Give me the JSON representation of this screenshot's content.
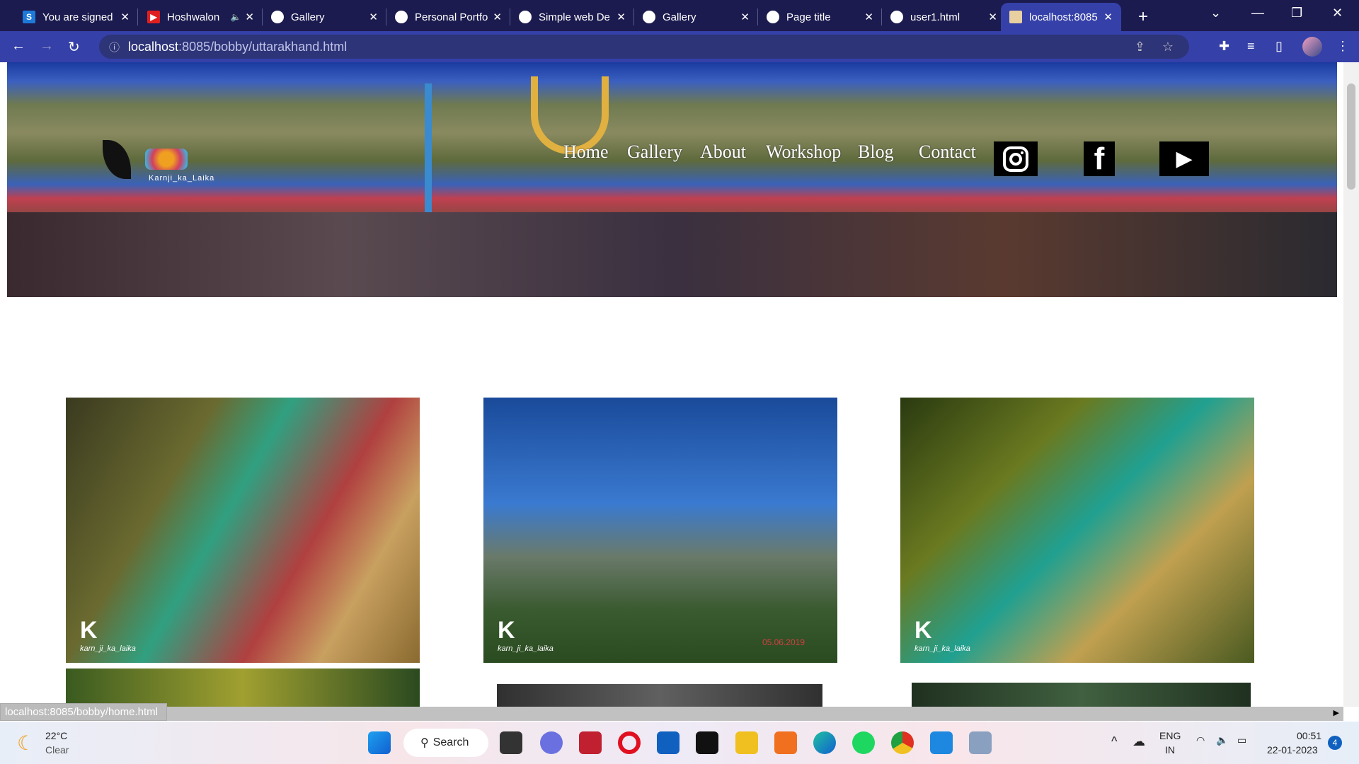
{
  "browser": {
    "tabs": [
      {
        "label": "You are signed",
        "icon": "s-icon",
        "color": "#1e7ad8"
      },
      {
        "label": "Hoshwalon",
        "icon": "youtube-icon",
        "color": "#e02020",
        "audio": true
      },
      {
        "label": "Gallery",
        "icon": "globe-icon"
      },
      {
        "label": "Personal Portfo",
        "icon": "globe-icon"
      },
      {
        "label": "Simple web De",
        "icon": "globe-icon"
      },
      {
        "label": "Gallery",
        "icon": "globe-icon"
      },
      {
        "label": "Page title",
        "icon": "globe-icon"
      },
      {
        "label": "user1.html",
        "icon": "globe-icon"
      },
      {
        "label": "localhost:8085",
        "icon": "tomcat-icon",
        "active": true
      }
    ],
    "url_host": "localhost",
    "url_rest": ":8085/bobby/uttarakhand.html",
    "status_url": "localhost:8085/bobby/home.html"
  },
  "site": {
    "logo_text": "Karnji_ka_Laika",
    "nav": [
      "Home",
      "Gallery",
      "About",
      "Workshop",
      "Blog",
      "Contact"
    ],
    "social": [
      "instagram-icon",
      "facebook-icon",
      "youtube-icon"
    ],
    "gallery": [
      {
        "watermark": "karn_ji_ka_laika"
      },
      {
        "watermark": "karn_ji_ka_laika",
        "date": "05.06.2019"
      },
      {
        "watermark": "karn_ji_ka_laika"
      }
    ]
  },
  "taskbar": {
    "weather_temp": "22°C",
    "weather_desc": "Clear",
    "search": "Search",
    "lang1": "ENG",
    "lang2": "IN",
    "time": "00:51",
    "date": "22-01-2023",
    "notifications": "4"
  }
}
